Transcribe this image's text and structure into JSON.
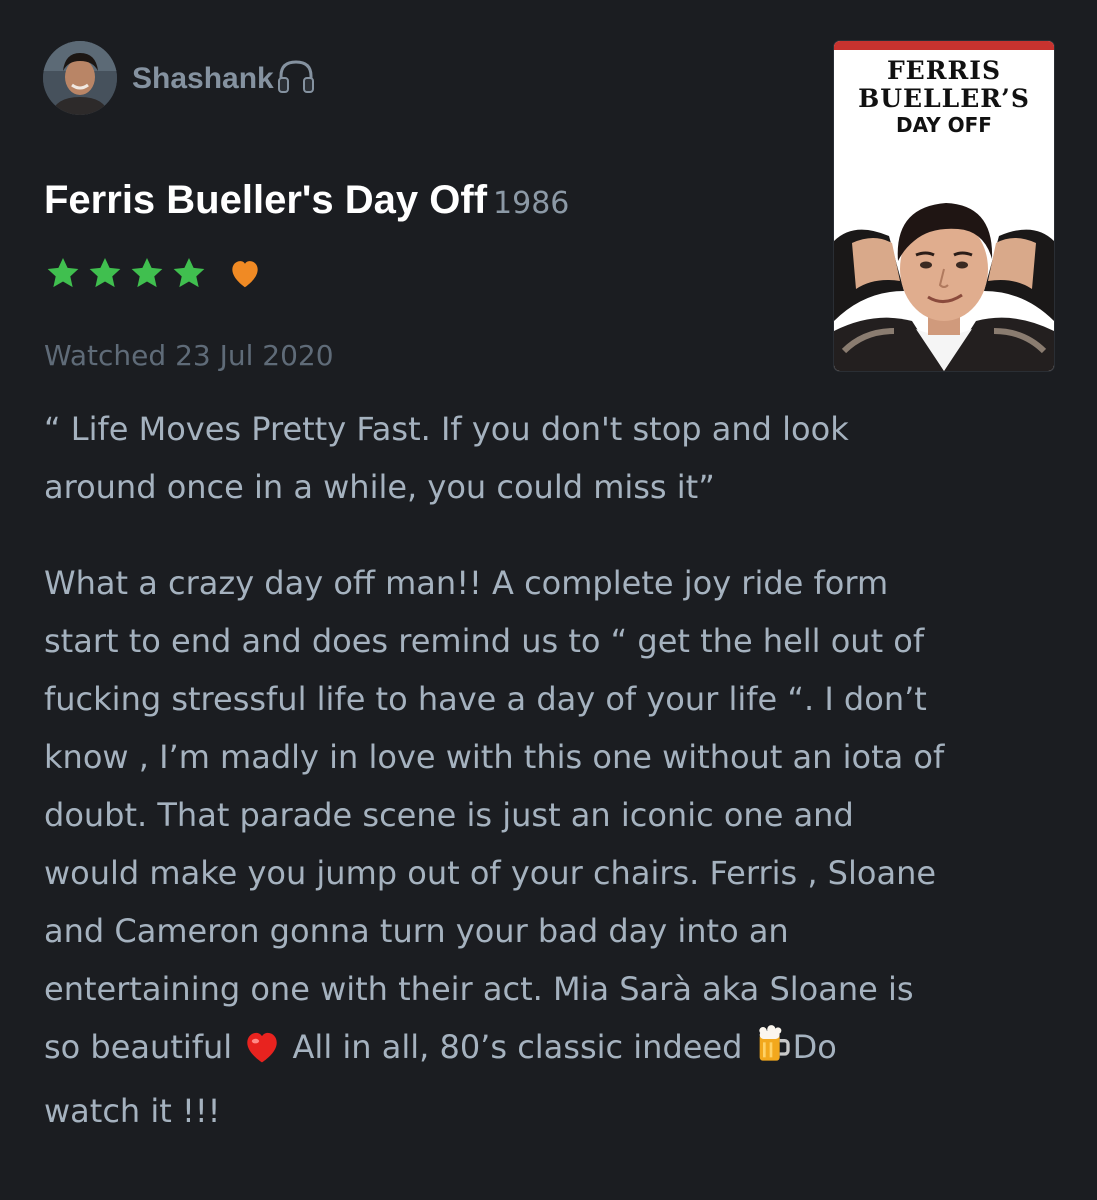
{
  "author": {
    "name": "Shashank",
    "badge_icon": "headphones-icon"
  },
  "film": {
    "title": "Ferris Bueller's Day Off",
    "year": "1986"
  },
  "rating": {
    "stars": 4,
    "max_stars": 5,
    "liked": true,
    "star_color": "#40bf4f",
    "heart_color": "#f08a24"
  },
  "watched": "Watched 23 Jul 2020",
  "poster": {
    "line1": "FERRIS",
    "line2": "BUELLER’S",
    "line3": "DAY OFF"
  },
  "review": {
    "quote_lines": [
      "“ Life Moves Pretty Fast. If you don't stop and look",
      "around once in a while, you could miss it”"
    ],
    "body_lines": [
      "What a crazy day off man!! A complete joy ride form",
      "start to end and does remind us to “ get the hell out of",
      "fucking stressful life to have a day of your life “.  I don’t",
      "know , I’m madly in love with this one without an iota of",
      "doubt. That parade scene is just an iconic one and",
      "would make you jump out of your chairs. Ferris , Sloane",
      "and Cameron gonna turn your bad day into an",
      "entertaining one with their act. Mia Sarà aka Sloane is"
    ],
    "line9_part1": "so beautiful ",
    "line9_part2": "   All in all, 80’s classic indeed ",
    "line9_part3": "Do",
    "line10": "watch it !!!"
  },
  "colors": {
    "background": "#1b1d21",
    "text": "#a5b2bf",
    "muted": "#5f6b78",
    "title": "#ffffff"
  }
}
